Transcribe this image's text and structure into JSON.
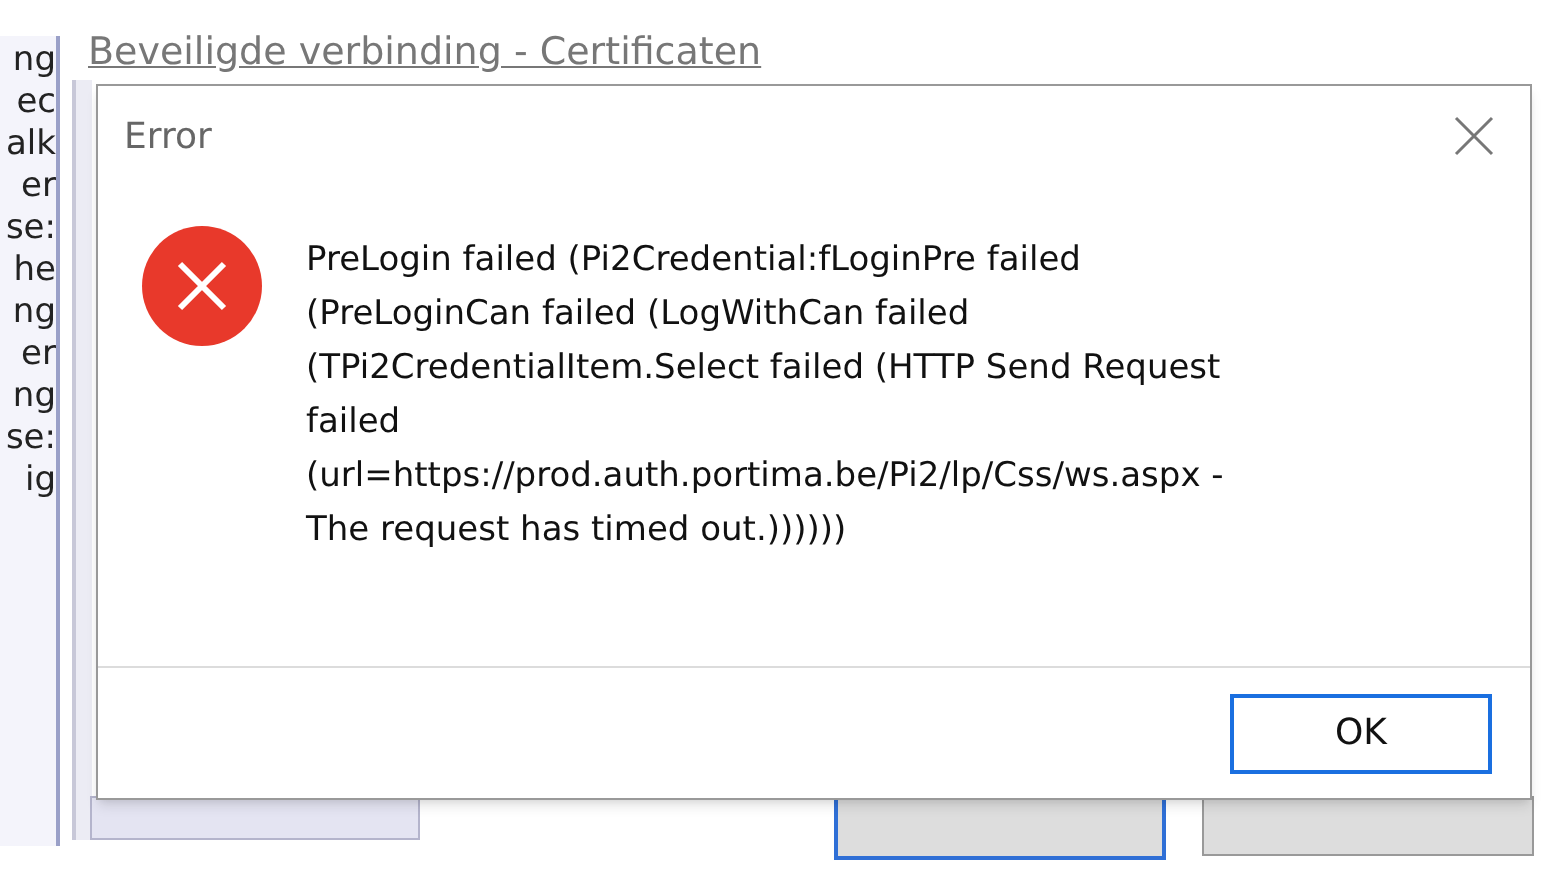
{
  "background_window": {
    "title": "Beveiligde verbinding - Certificaten",
    "side_fragments": [
      "ng",
      "ec",
      "alk",
      "er",
      "se:",
      "he",
      "ng",
      "er",
      "ng",
      "se:",
      "ig"
    ]
  },
  "dialog": {
    "title": "Error",
    "message": "PreLogin failed (Pi2Credential:fLoginPre failed (PreLoginCan failed (LogWithCan failed (TPi2CredentialItem.Select failed (HTTP Send Request failed (url=https://prod.auth.portima.be/Pi2/lp/Css/ws.aspx - The request has timed out.))))))",
    "buttons": [
      {
        "label": "OK",
        "selected": true
      }
    ]
  }
}
